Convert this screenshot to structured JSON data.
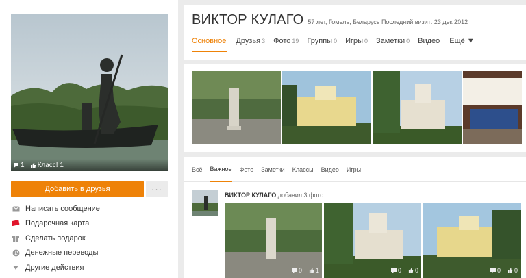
{
  "profile": {
    "name": "ВИКТОР КУЛАГО",
    "meta": "57 лет, Гомель, Беларусь  Последний визит: 23 дек 2012"
  },
  "avatar": {
    "comments": "1",
    "klass": "Класс! 1"
  },
  "buttons": {
    "add_friend": "Добавить в друзья",
    "more": "···"
  },
  "actions": [
    {
      "label": "Написать сообщение",
      "icon": "envelope-icon"
    },
    {
      "label": "Подарочная карта",
      "icon": "gift-card-icon"
    },
    {
      "label": "Сделать подарок",
      "icon": "gift-icon"
    },
    {
      "label": "Денежные переводы",
      "icon": "money-transfer-icon"
    },
    {
      "label": "Другие действия",
      "icon": "triangle-down-icon"
    }
  ],
  "tabs": [
    {
      "label": "Основное",
      "count": ""
    },
    {
      "label": "Друзья",
      "count": "3"
    },
    {
      "label": "Фото",
      "count": "19"
    },
    {
      "label": "Группы",
      "count": "0"
    },
    {
      "label": "Игры",
      "count": "0"
    },
    {
      "label": "Заметки",
      "count": "0"
    },
    {
      "label": "Видео",
      "count": ""
    },
    {
      "label": "Ещё ▼",
      "count": ""
    }
  ],
  "feed_tabs": [
    "Всё",
    "Важное",
    "Фото",
    "Заметки",
    "Классы",
    "Видео",
    "Игры"
  ],
  "post": {
    "author": "ВИКТОР КУЛАГО",
    "action": " добавил 3 фото",
    "photos": [
      {
        "comments": "0",
        "likes": "1"
      },
      {
        "comments": "0",
        "likes": "0"
      },
      {
        "comments": "0",
        "likes": "0"
      }
    ]
  },
  "colors": {
    "accent": "#ee8208",
    "background": "#ebebeb"
  }
}
